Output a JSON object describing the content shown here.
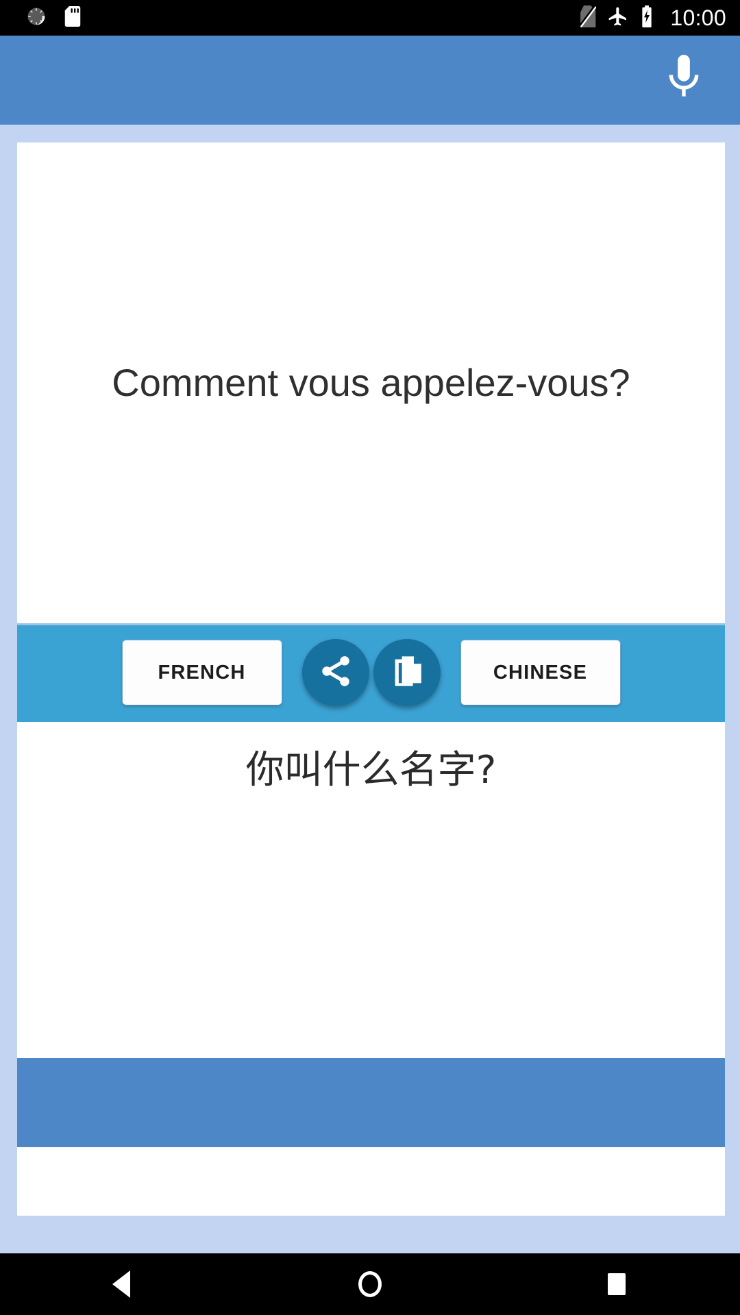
{
  "status_bar": {
    "clock": "10:00",
    "left_icons": [
      "sync-disabled-icon",
      "sd-card-icon"
    ],
    "right_icons": [
      "no-sim-icon",
      "airplane-mode-icon",
      "battery-charging-icon"
    ]
  },
  "app_bar": {
    "mic_icon": "microphone-icon",
    "background_color": "#4d87c7"
  },
  "translation": {
    "source_text": "Comment vous appelez-vous?",
    "target_text": "你叫什么名字?"
  },
  "action_bar": {
    "background_color": "#3ba2d4",
    "source_language": "FRENCH",
    "target_language": "CHINESE",
    "share_icon": "share-icon",
    "copy_icon": "copy-icon",
    "fab_color": "#16719e"
  },
  "footer": {
    "banner_color": "#4d87c7"
  },
  "nav_bar": {
    "back_icon": "back-triangle-icon",
    "home_icon": "home-circle-icon",
    "recents_icon": "recents-square-icon"
  },
  "theme": {
    "page_background": "#c3d4f2",
    "card_background": "#ffffff",
    "text_color": "#2f2f2f"
  }
}
